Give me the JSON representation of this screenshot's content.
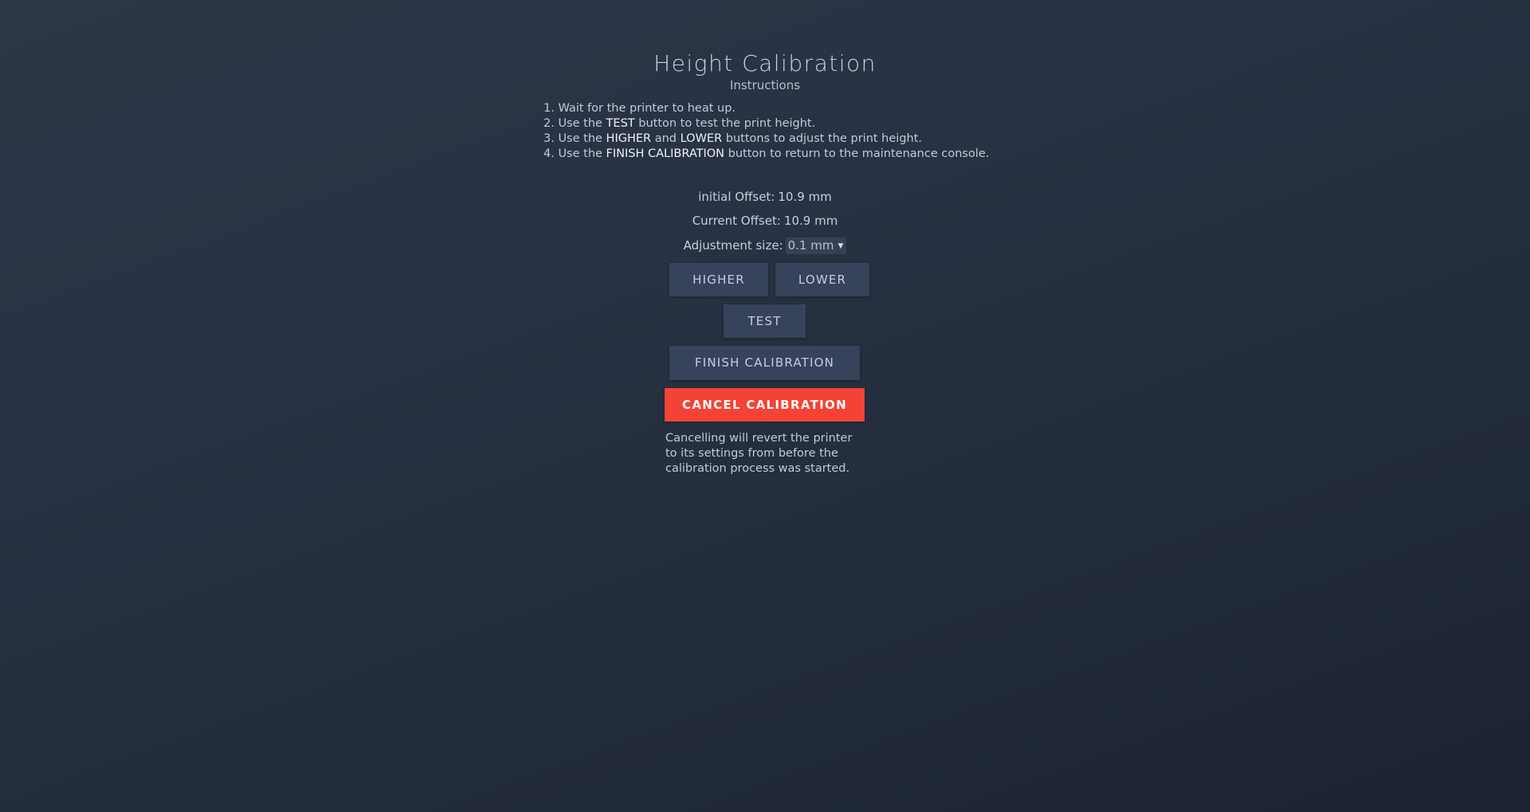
{
  "header": {
    "title": "Height Calibration",
    "subtitle": "Instructions"
  },
  "instructions": [
    {
      "pre": "1. Wait for the printer to heat up.",
      "kw1": "",
      "mid": "",
      "kw2": "",
      "post": ""
    },
    {
      "pre": "2. Use the ",
      "kw1": "TEST",
      "mid": " button to test the print height.",
      "kw2": "",
      "post": ""
    },
    {
      "pre": "3. Use the ",
      "kw1": "HIGHER",
      "mid": " and ",
      "kw2": "LOWER",
      "post": " buttons to adjust the print height."
    },
    {
      "pre": "4. Use the ",
      "kw1": "FINISH CALIBRATION",
      "mid": " button to return to the maintenance console.",
      "kw2": "",
      "post": ""
    }
  ],
  "offsets": {
    "initial_label": "initial Offset:",
    "initial_value": "10.9 mm",
    "current_label": "Current Offset:",
    "current_value": "10.9 mm"
  },
  "adjustment": {
    "label": "Adjustment size:",
    "selected": "0.1 mm"
  },
  "buttons": {
    "higher": "HIGHER",
    "lower": "LOWER",
    "test": "TEST",
    "finish": "FINISH CALIBRATION",
    "cancel": "CANCEL CALIBRATION"
  },
  "note": "Cancelling will revert the printer to its settings from before the calibration process was started.",
  "colors": {
    "cancel_bg": "#f44336",
    "button_bg": "#36435a",
    "background": "#283244"
  },
  "icons": {
    "select_caret": "chevron-down-icon"
  }
}
